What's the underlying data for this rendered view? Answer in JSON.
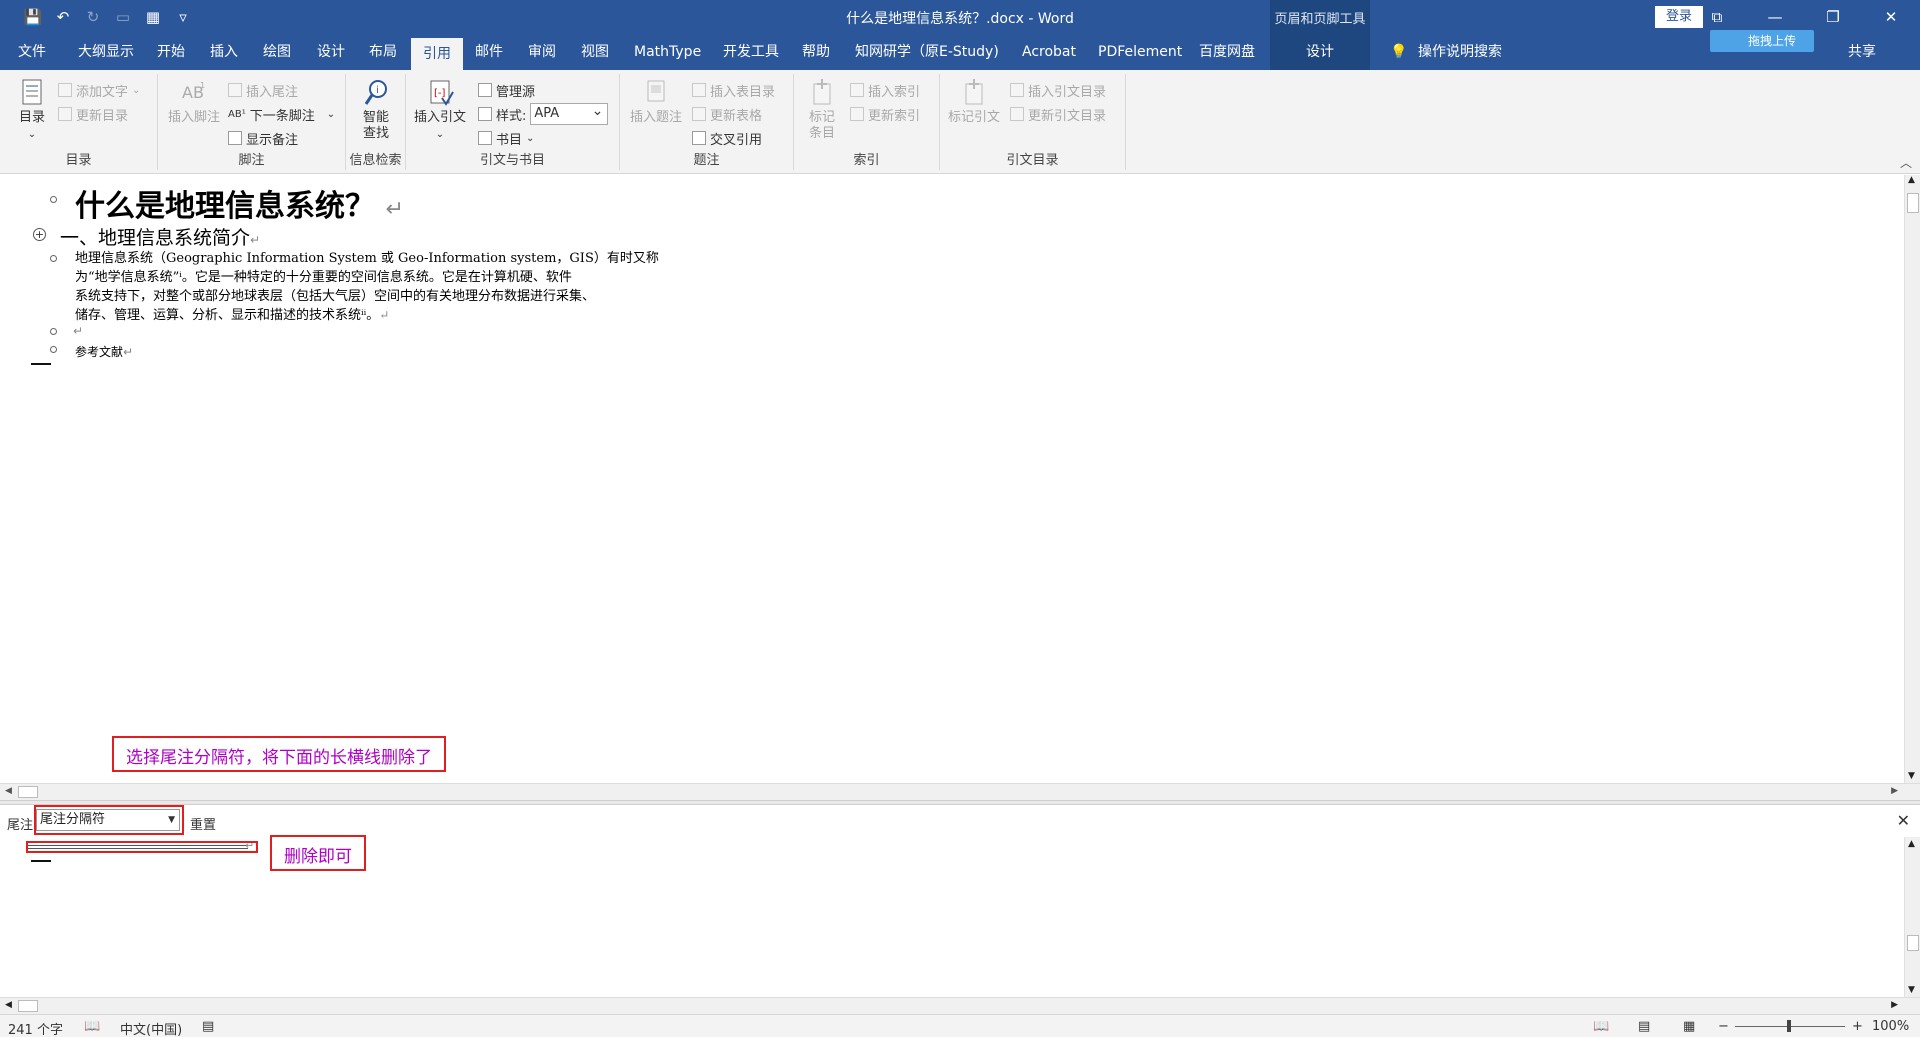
{
  "window": {
    "title": "什么是地理信息系统？.docx  -  Word",
    "contextual_tools": "页眉和页脚工具",
    "login": "登录",
    "minimize": "—",
    "restore": "❐",
    "close": "✕"
  },
  "qat": {
    "save": "💾",
    "undo": "↶",
    "redo": "↻",
    "new": "▭",
    "table": "▦",
    "more": "▿"
  },
  "tabs": [
    {
      "label": "文件"
    },
    {
      "label": "大纲显示"
    },
    {
      "label": "开始"
    },
    {
      "label": "插入"
    },
    {
      "label": "绘图"
    },
    {
      "label": "设计"
    },
    {
      "label": "布局"
    },
    {
      "label": "引用"
    },
    {
      "label": "邮件"
    },
    {
      "label": "审阅"
    },
    {
      "label": "视图"
    },
    {
      "label": "MathType"
    },
    {
      "label": "开发工具"
    },
    {
      "label": "帮助"
    },
    {
      "label": "知网研学（原E-Study)"
    },
    {
      "label": "Acrobat"
    },
    {
      "label": "PDFelement"
    },
    {
      "label": "百度网盘"
    },
    {
      "label": "设计"
    }
  ],
  "tell_me": "操作说明搜索",
  "upload": "拖拽上传",
  "share": "共享",
  "ribbon": {
    "toc": {
      "button": "目录",
      "add_text": "添加文字",
      "update": "更新目录",
      "label": "目录"
    },
    "footnotes": {
      "insert_footnote": "插入脚注",
      "insert_endnote": "插入尾注",
      "next_footnote": "下一条脚注",
      "show_notes": "显示备注",
      "label": "脚注"
    },
    "research": {
      "smart_lookup_1": "智能",
      "smart_lookup_2": "查找",
      "label": "信息检索"
    },
    "citations": {
      "insert_citation": "插入引文",
      "manage_sources": "管理源",
      "style_label": "样式:",
      "style_value": "APA",
      "bibliography": "书目",
      "label": "引文与书目"
    },
    "captions": {
      "insert_caption": "插入题注",
      "insert_tof": "插入表目录",
      "update_table": "更新表格",
      "cross_ref": "交叉引用",
      "label": "题注"
    },
    "index": {
      "mark_entry_1": "标记",
      "mark_entry_2": "条目",
      "insert_index": "插入索引",
      "update_index": "更新索引",
      "label": "索引"
    },
    "toa": {
      "mark_citation": "标记引文",
      "insert_toa": "插入引文目录",
      "update_toa": "更新引文目录",
      "label": "引文目录"
    }
  },
  "document": {
    "title": "什么是地理信息系统？",
    "heading1": "一、地理信息系统简介",
    "body_lines": [
      "地理信息系统（Geographic Information System 或 Geo-Information system，GIS）有时又称",
      "为“地学信息系统”ⁱ。它是一种特定的十分重要的空间信息系统。它是在计算机硬、软件",
      "系统支持下，对整个或部分地球表层（包括大气层）空间中的有关地理分布数据进行采集、",
      "储存、管理、运算、分析、显示和描述的技术系统ⁱⁱ。"
    ],
    "references": "参考文献",
    "para_mark": "↵"
  },
  "annotations": {
    "top": "选择尾注分隔符，将下面的长横线删除了",
    "bottom": "删除即可"
  },
  "endnote_pane": {
    "label": "尾注",
    "selected": "尾注分隔符",
    "reset": "重置",
    "close": "✕"
  },
  "status": {
    "word_count": "241 个字",
    "language": "中文(中国)",
    "zoom_minus": "−",
    "zoom_plus": "+",
    "zoom": "100%"
  },
  "colors": {
    "accent": "#2b579a",
    "annotation_border": "#e02020",
    "annotation_text": "#b000c8"
  }
}
